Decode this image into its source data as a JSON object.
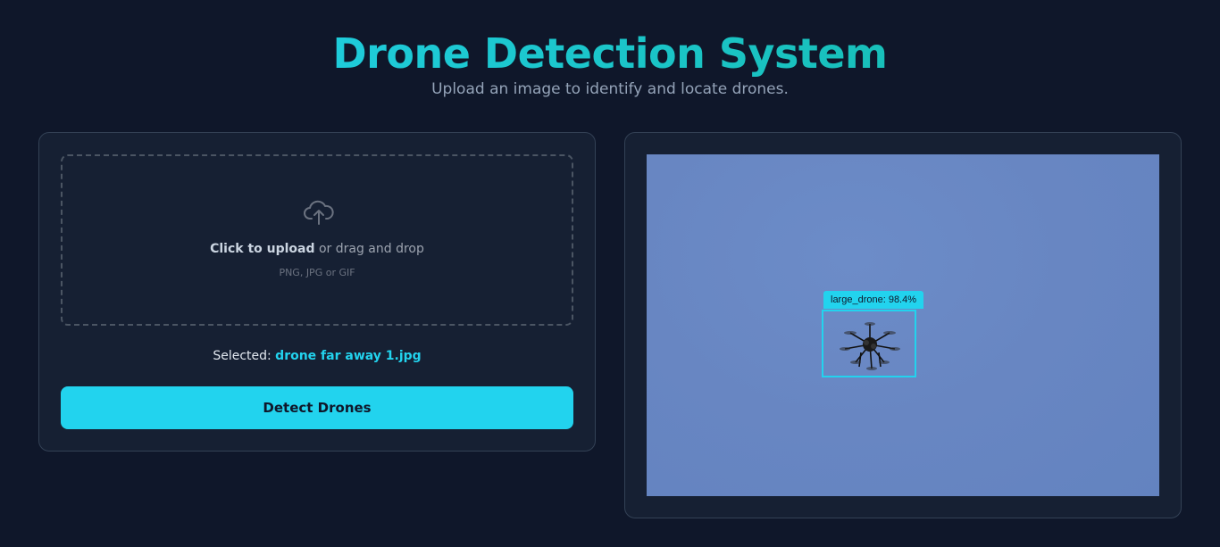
{
  "header": {
    "title": "Drone Detection System",
    "subtitle": "Upload an image to identify and locate drones."
  },
  "upload": {
    "icon": "cloud-upload-icon",
    "click_label": "Click to upload",
    "drag_label": " or drag and drop",
    "hint": "PNG, JPG or GIF"
  },
  "selection": {
    "prefix": "Selected: ",
    "filename": "drone far away 1.jpg"
  },
  "actions": {
    "detect_label": "Detect Drones"
  },
  "result": {
    "detection_label": "large_drone: 98.4%",
    "accent_color": "#22d3ee",
    "image_color": "#6886c2"
  },
  "colors": {
    "background": "#0f172a",
    "card": "#162033",
    "accent": "#22d3ee",
    "accent_secondary": "#14b8a6"
  }
}
